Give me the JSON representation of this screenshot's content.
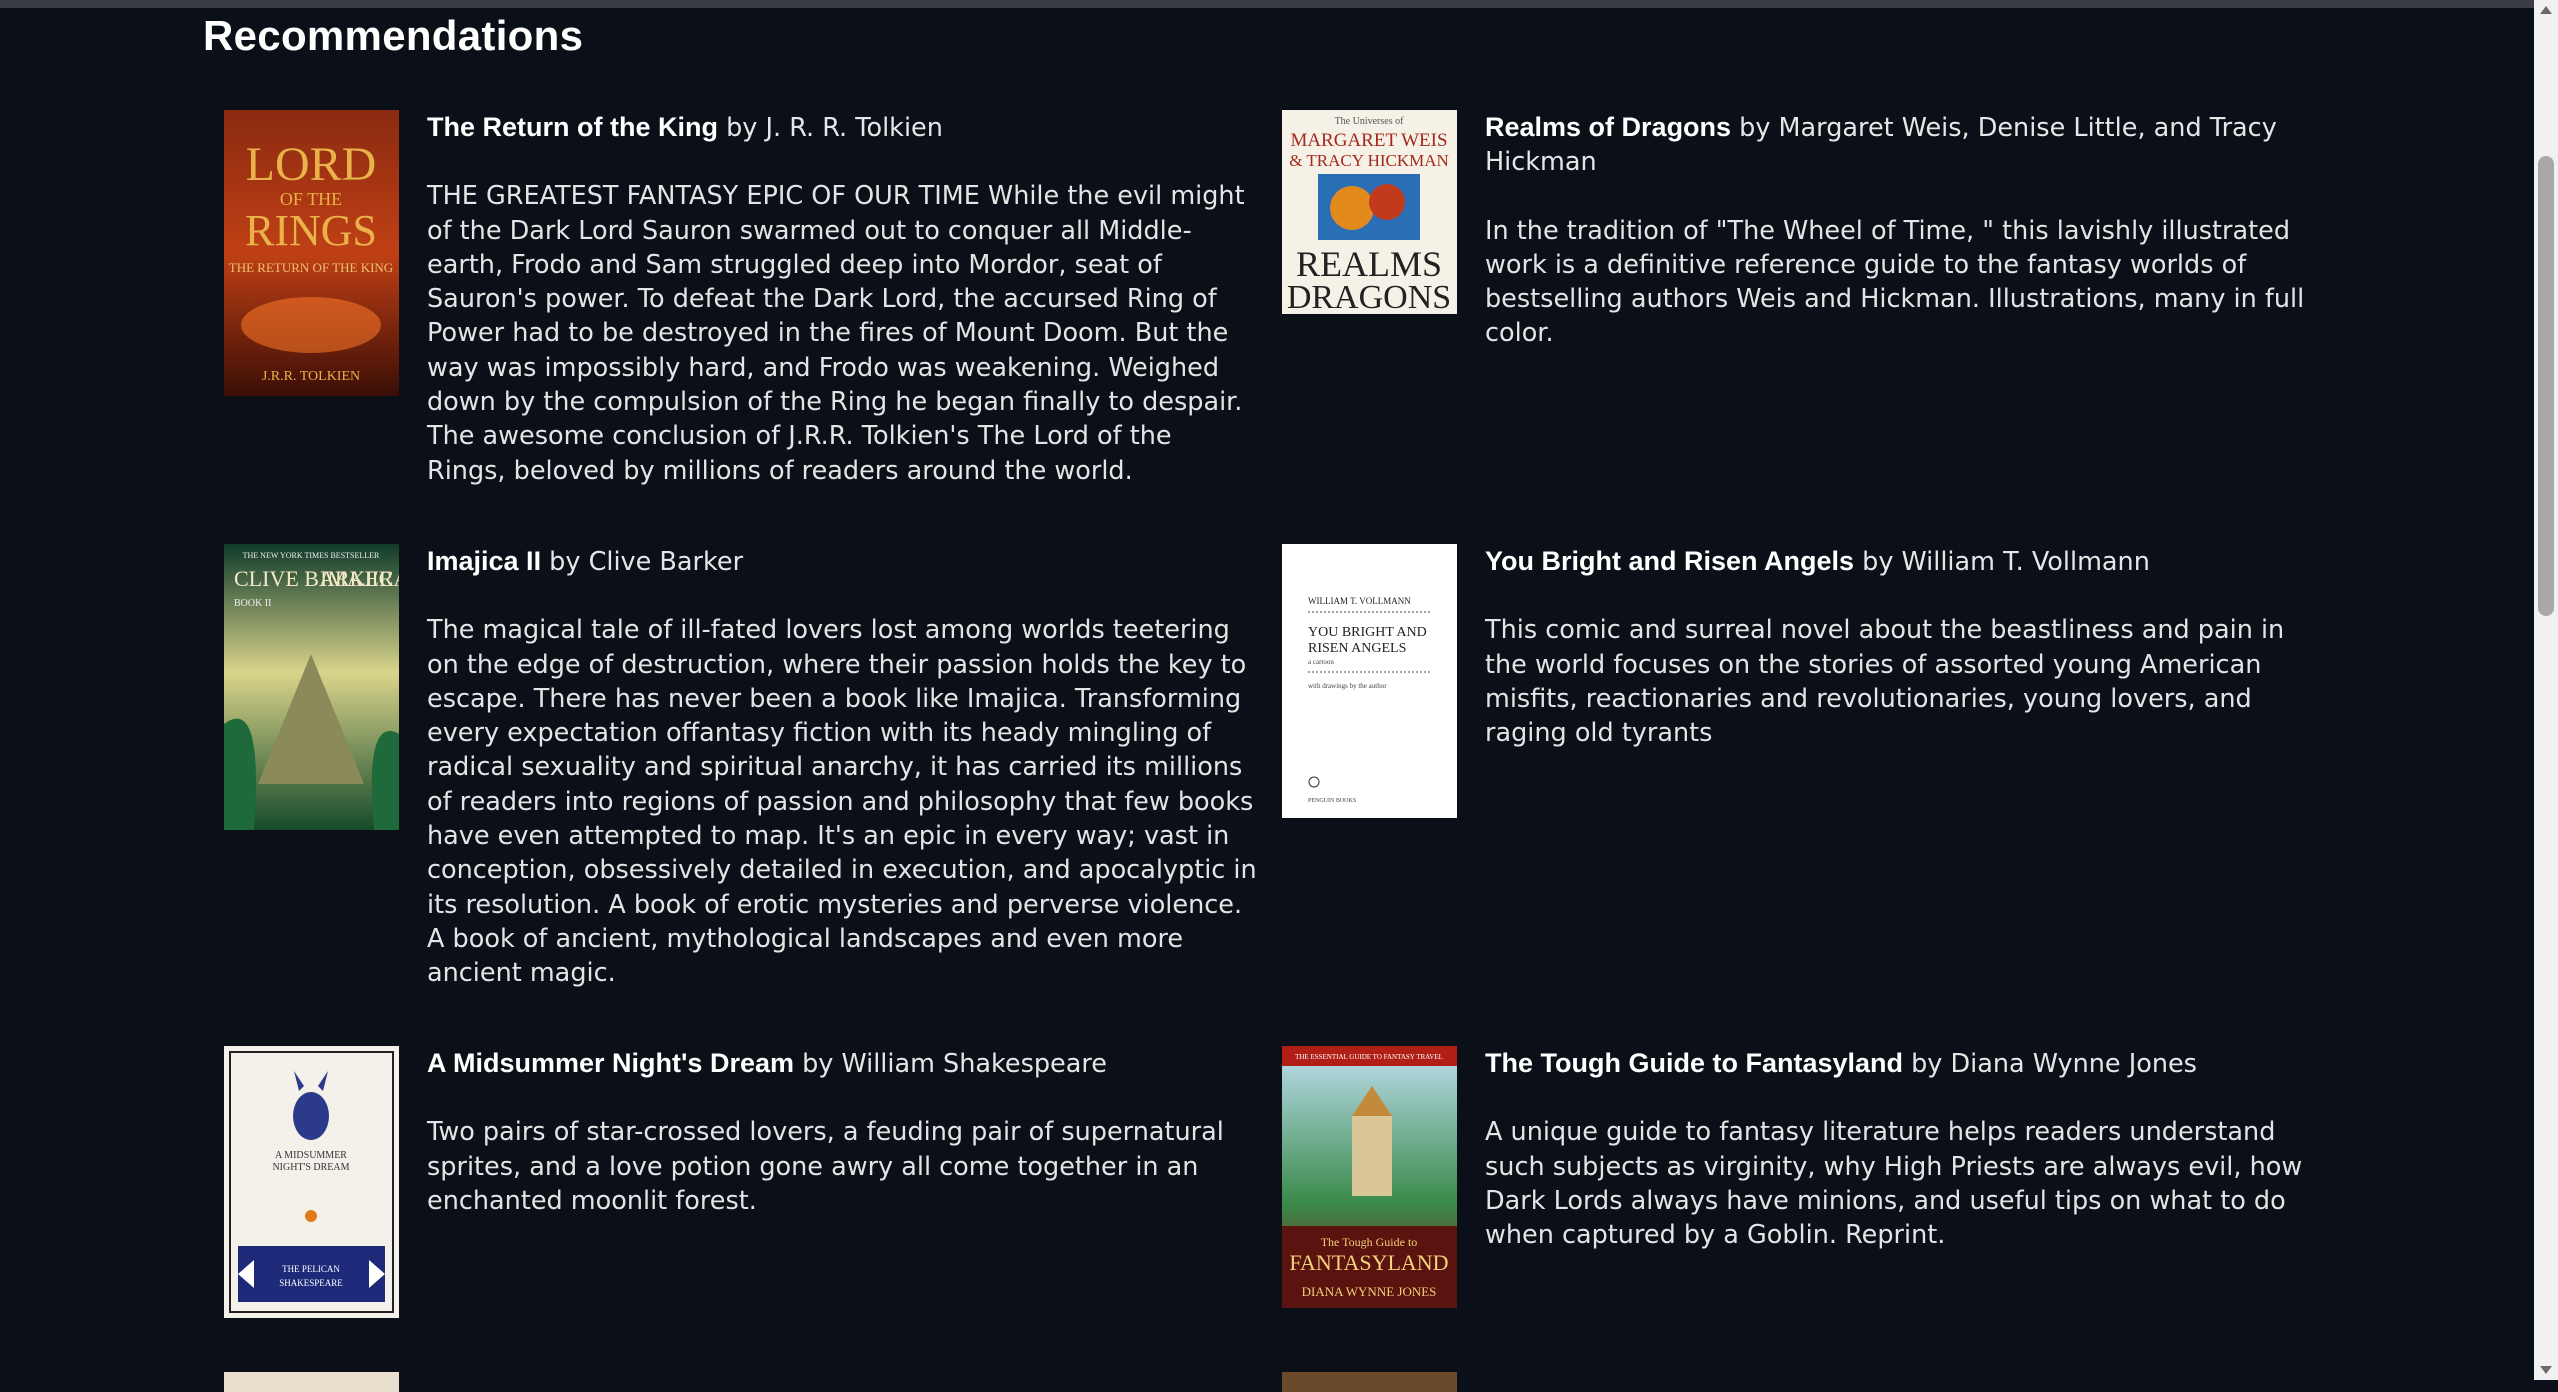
{
  "page": {
    "title": "Recommendations"
  },
  "books": [
    {
      "title": "The Return of the King",
      "by": " by J. R. R. Tolkien",
      "description": "THE GREATEST FANTASY EPIC OF OUR TIME While the evil might of the Dark Lord Sauron swarmed out to conquer all Middle-earth, Frodo and Sam struggled deep into Mordor, seat of Sauron's power. To defeat the Dark Lord, the accursed Ring of Power had to be destroyed in the fires of Mount Doom. But the way was impossibly hard, and Frodo was weakening. Weighed down by the compulsion of the Ring he began finally to despair. The awesome conclusion of J.R.R. Tolkien's The Lord of the Rings, beloved by millions of readers around the world.",
      "cover": {
        "line1": "LORD",
        "line2": "RINGS",
        "line3": "THE RETURN OF THE KING",
        "line4": "J.R.R. TOLKIEN"
      }
    },
    {
      "title": "Realms of Dragons",
      "by": " by Margaret Weis, Denise Little, and Tracy Hickman",
      "description": "In the tradition of \"The Wheel of Time, \" this lavishly illustrated work is a definitive reference guide to the fantasy worlds of bestselling authors Weis and Hickman. Illustrations, many in full color.",
      "cover": {
        "line1": "The Universes of",
        "line2": "MARGARET WEIS",
        "line3": "& TRACY HICKMAN",
        "line4": "REALMS",
        "line5": "DRAGONS"
      }
    },
    {
      "title": "Imajica II",
      "by": " by Clive Barker",
      "description": "The magical tale of ill-fated lovers lost among worlds teetering on the edge of destruction, where their passion holds the key to escape. There has never been a book like Imajica. Transforming every expectation offantasy fiction with its heady mingling of radical sexuality and spiritual anarchy, it has carried its millions of readers into regions of passion and philosophy that few books have even attempted to map. It's an epic in every way; vast in conception, obsessively detailed in execution, and apocalyptic in its resolution. A book of erotic mysteries and perverse violence. A book of ancient, mythological landscapes and even more ancient magic.",
      "cover": {
        "line1": "THE NEW YORK TIMES BESTSELLER",
        "line2": "CLIVE BARKER",
        "line3": "IMAJICA",
        "line4": "BOOK II"
      }
    },
    {
      "title": "You Bright and Risen Angels",
      "by": " by William T. Vollmann",
      "description": "This comic and surreal novel about the beastliness and pain in the world focuses on the stories of assorted young American misfits, reactionaries and revolutionaries, young lovers, and raging old tyrants",
      "cover": {
        "line1": "WILLIAM T. VOLLMANN",
        "line2": "YOU BRIGHT AND",
        "line3": "RISEN ANGELS",
        "line4": "a cartoon",
        "line5": "with drawings by the author",
        "line6": "PENGUIN BOOKS"
      }
    },
    {
      "title": "A Midsummer Night's Dream",
      "by": " by William Shakespeare",
      "description": "Two pairs of star-crossed lovers, a feuding pair of supernatural sprites, and a love potion gone awry all come together in an enchanted moonlit forest.",
      "cover": {
        "line1": "A MIDSUMMER",
        "line2": "NIGHT'S DREAM",
        "line3": "THE PELICAN",
        "line4": "SHAKESPEARE"
      }
    },
    {
      "title": "The Tough Guide to Fantasyland",
      "by": " by Diana Wynne Jones",
      "description": "A unique guide to fantasy literature helps readers understand such subjects as virginity, why High Priests are always evil, how Dark Lords always have minions, and useful tips on what to do when captured by a Goblin. Reprint.",
      "cover": {
        "line1": "THE ESSENTIAL GUIDE TO FANTASY TRAVEL",
        "line2": "The Tough Guide to",
        "line3": "FANTASYLAND",
        "line4": "DIANA WYNNE JONES"
      }
    }
  ]
}
